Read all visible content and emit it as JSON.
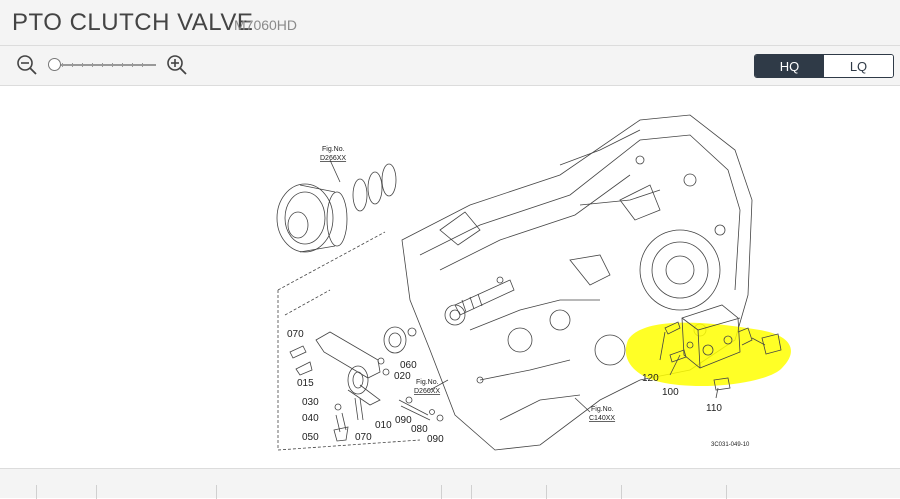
{
  "header": {
    "title": "PTO CLUTCH VALVE",
    "model": "M7060HD"
  },
  "toolbar": {
    "zoom_out_icon": "zoom-out-icon",
    "zoom_in_icon": "zoom-in-icon",
    "zoom_level": 0,
    "quality": {
      "hq_label": "HQ",
      "lq_label": "LQ",
      "selected": "HQ"
    }
  },
  "diagram": {
    "highlight_color": "#ffff00",
    "callouts": {
      "c070": "070",
      "c015": "015",
      "c030": "030",
      "c040": "040",
      "c050": "050",
      "c060": "060",
      "c020": "020",
      "c010": "010",
      "c070b": "070",
      "c090": "090",
      "c080": "080",
      "c090b": "090",
      "c120": "120",
      "c100": "100",
      "c110": "110"
    },
    "fig_refs": {
      "fig1_label": "Fig.No.",
      "fig1_code": "D266XX",
      "fig2_label": "Fig.No.",
      "fig2_code": "D266XX",
      "fig3_label": "Fig.No.",
      "fig3_code": "C140XX"
    },
    "drawing_id": "3C031-049-10"
  }
}
